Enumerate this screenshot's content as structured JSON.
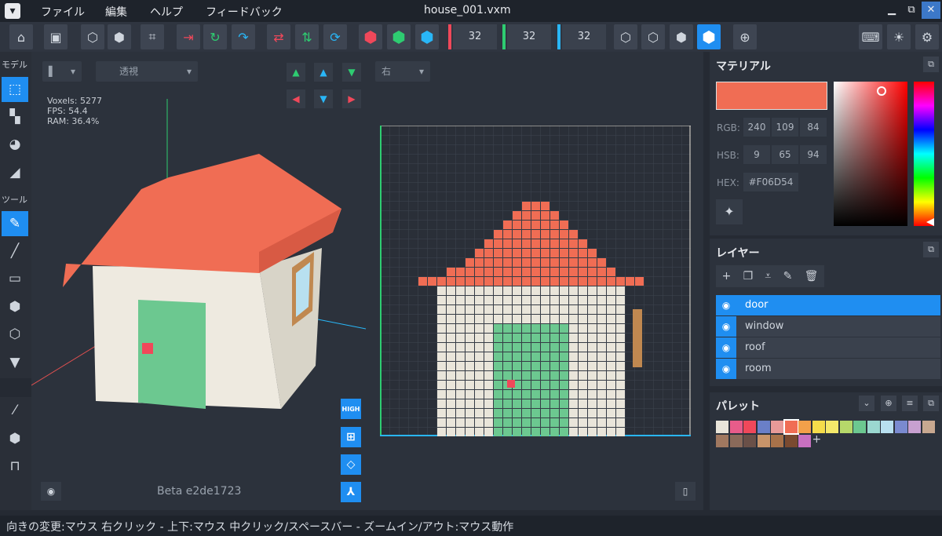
{
  "window": {
    "title": "house_001.vxm",
    "minimize": "▁",
    "maximize": "⧉",
    "close": "✕"
  },
  "menu": [
    "ファイル",
    "編集",
    "ヘルプ",
    "フィードバック"
  ],
  "toolbar": {
    "dims": [
      {
        "value": "32",
        "color": "#f0485a"
      },
      {
        "value": "32",
        "color": "#2ecc71"
      },
      {
        "value": "32",
        "color": "#29b6f6"
      }
    ],
    "icon_names": [
      "home-icon",
      "save-icon",
      "cube-export-icon",
      "cube-import-icon",
      "crop-icon",
      "exit-icon",
      "loop-icon",
      "redo-icon",
      "swap-horizontal-icon",
      "swap-vertical-icon",
      "rotate-icon",
      "red-cube-icon",
      "green-cube-icon",
      "blue-cube-icon",
      "wireframe-cube-icon",
      "solid-cube-icon",
      "textured-cube-icon",
      "white-cube-icon",
      "target-icon",
      "keyboard-icon",
      "lightbulb-icon",
      "gear-icon"
    ]
  },
  "leftbar": {
    "section_model": "モデル",
    "section_tools": "ツール"
  },
  "viewport": {
    "left_dropdown_value": "▌",
    "projection": "透視",
    "view_direction": "右",
    "stats": {
      "voxels": "Voxels: 5277",
      "fps": "FPS: 54.4",
      "ram": "RAM: 36.4%"
    },
    "quality_label": "HIGH",
    "version": "Beta e2de1723"
  },
  "material": {
    "title": "マテリアル",
    "swatch_color": "#F06D54",
    "rgb_label": "RGB:",
    "rgb": [
      "240",
      "109",
      "84"
    ],
    "hsb_label": "HSB:",
    "hsb": [
      "9",
      "65",
      "94"
    ],
    "hex_label": "HEX:",
    "hex": "#F06D54"
  },
  "layers": {
    "title": "レイヤー",
    "items": [
      {
        "name": "door",
        "active": true
      },
      {
        "name": "window",
        "active": false
      },
      {
        "name": "roof",
        "active": false
      },
      {
        "name": "room",
        "active": false
      }
    ]
  },
  "palette": {
    "title": "パレット",
    "add_label": "+",
    "colors": [
      "#e9e5da",
      "#e85c8a",
      "#f0485a",
      "#6a7fc8",
      "#e89a98",
      "#f06d54",
      "#f3a04a",
      "#f5dc4a",
      "#f4e86a",
      "#b6d86a",
      "#6cc890",
      "#9bd8d0",
      "#b8e0f0",
      "#7a8ad0",
      "#c8a0d0",
      "#c8a890",
      "#a07860",
      "#8a6a5a",
      "#6a5048",
      "#c8946a",
      "#a8724a",
      "#7a4a30",
      "#c870c0"
    ],
    "selected_index": 5
  },
  "statusbar": {
    "text": "向きの変更:マウス 右クリック - 上下:マウス 中クリック/スペースバー - ズームイン/アウト:マウス動作"
  }
}
